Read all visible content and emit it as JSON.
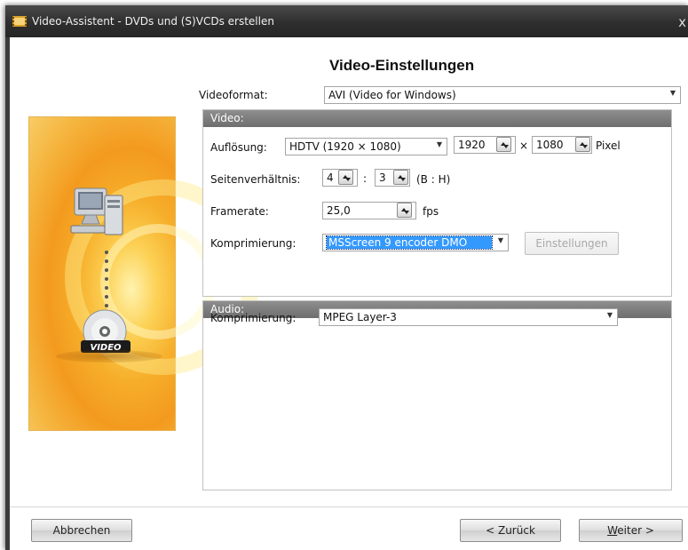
{
  "window": {
    "title": "Video-Assistent - DVDs und (S)VCDs erstellen",
    "close_glyph": "x"
  },
  "heading": "Video-Einstellungen",
  "videoformat": {
    "label": "Videoformat:",
    "value": "AVI (Video for Windows)"
  },
  "video_group": {
    "title": "Video:",
    "resolution": {
      "label": "Auflösung:",
      "preset": "HDTV (1920 × 1080)",
      "width": "1920",
      "times": "×",
      "height": "1080",
      "unit": "Pixel"
    },
    "aspect": {
      "label": "Seitenverhältnis:",
      "w": "4",
      "colon": ":",
      "h": "3",
      "hint": "(B : H)"
    },
    "framerate": {
      "label": "Framerate:",
      "value": "25,0",
      "unit": "fps"
    },
    "compression": {
      "label": "Komprimierung:",
      "value": "MSScreen 9 encoder DMO",
      "settings_button": "Einstellungen"
    }
  },
  "audio_group": {
    "title": "Audio:",
    "compression": {
      "label": "Komprimierung:",
      "value": "MPEG Layer-3"
    }
  },
  "buttons": {
    "cancel": "Abbrechen",
    "back": "< Zurück",
    "next_underlined": "W",
    "next_rest": "eiter >"
  },
  "banner": {
    "disc_label": "VIDEO"
  },
  "colors": {
    "selection": "#3399ff",
    "group_header": "#7a7a7a",
    "banner_orange": "#f39a1e"
  },
  "icons": [
    "computer-icon",
    "dvd-video-icon",
    "spin-arrows-icon",
    "chevron-down-icon"
  ]
}
